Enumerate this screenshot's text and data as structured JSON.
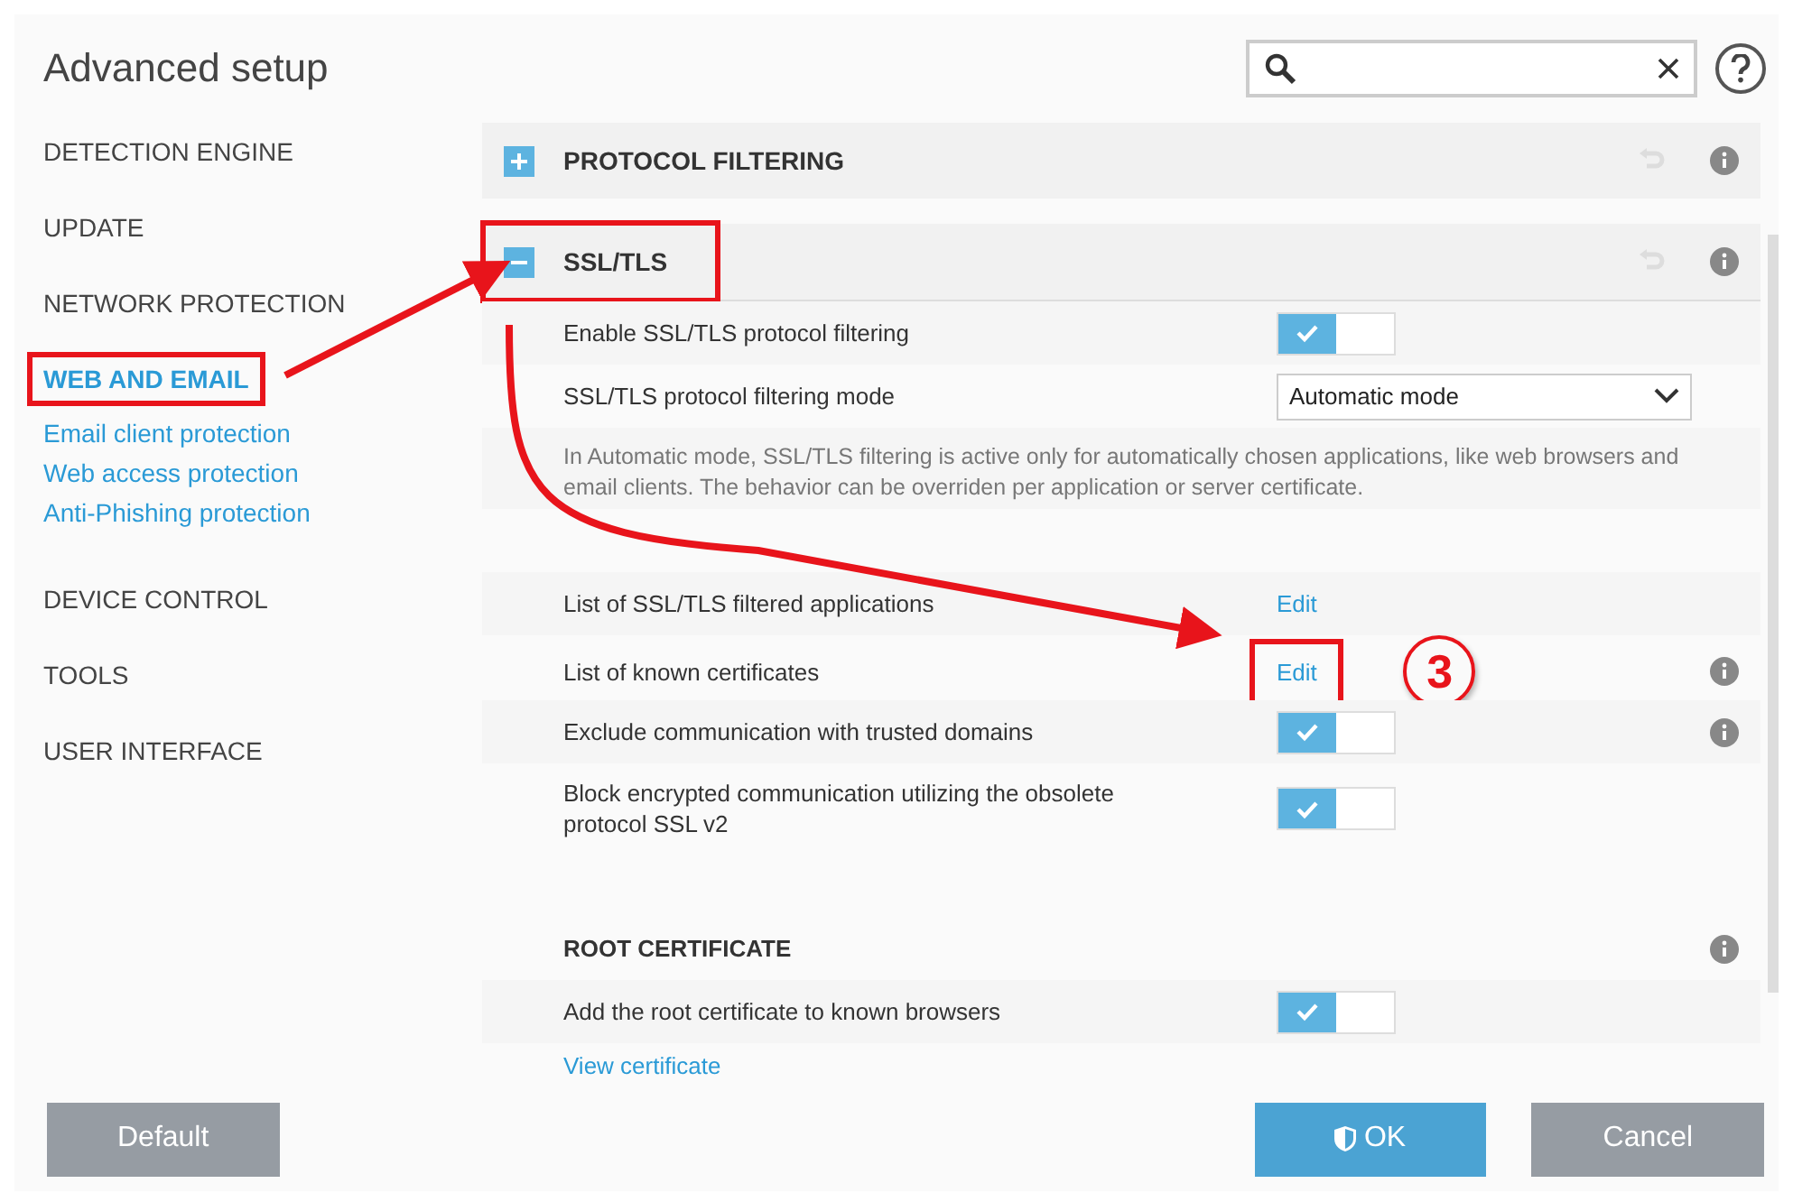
{
  "window": {
    "title": "Advanced setup"
  },
  "sidebar": {
    "items": [
      {
        "label": "DETECTION ENGINE",
        "selected": false,
        "highlighted": false
      },
      {
        "label": "UPDATE",
        "selected": false,
        "highlighted": false
      },
      {
        "label": "NETWORK PROTECTION",
        "selected": false,
        "highlighted": false
      },
      {
        "label": "WEB AND EMAIL",
        "selected": true,
        "highlighted": true,
        "children": [
          {
            "label": "Email client protection"
          },
          {
            "label": "Web access protection"
          },
          {
            "label": "Anti-Phishing protection"
          }
        ]
      },
      {
        "label": "DEVICE CONTROL",
        "selected": false,
        "highlighted": false
      },
      {
        "label": "TOOLS",
        "selected": false,
        "highlighted": false
      },
      {
        "label": "USER INTERFACE",
        "selected": false,
        "highlighted": false
      }
    ]
  },
  "sections": [
    {
      "title": "PROTOCOL FILTERING",
      "expanded": false,
      "highlighted": false
    },
    {
      "title": "SSL/TLS",
      "expanded": true,
      "highlighted": true,
      "rows": [
        {
          "kind": "toggle",
          "label": "Enable SSL/TLS protocol filtering",
          "on": true,
          "info": false
        },
        {
          "kind": "select",
          "label": "SSL/TLS protocol filtering mode",
          "value": "Automatic mode"
        },
        {
          "kind": "note",
          "text": "In Automatic mode, SSL/TLS filtering is active only for automatically chosen applications, like web browsers and email clients. The behavior can be overriden per application or server certificate."
        },
        {
          "kind": "spacer"
        },
        {
          "kind": "link",
          "label": "List of SSL/TLS filtered applications",
          "link": "Edit",
          "highlighted": false,
          "info": false
        },
        {
          "kind": "link",
          "label": "List of known certificates",
          "link": "Edit",
          "highlighted": true,
          "step": "3",
          "info": true
        },
        {
          "kind": "toggle",
          "label": "Exclude communication with trusted domains",
          "on": true,
          "info": true
        },
        {
          "kind": "toggle",
          "label": "Block encrypted communication utilizing the obsolete protocol SSL v2",
          "on": true,
          "info": false
        },
        {
          "kind": "spacer"
        },
        {
          "kind": "heading",
          "label": "ROOT CERTIFICATE",
          "info": true
        },
        {
          "kind": "toggle",
          "label": "Add the root certificate to known browsers",
          "on": true,
          "info": false
        },
        {
          "kind": "action",
          "label": "View certificate"
        }
      ]
    }
  ],
  "buttons": [
    {
      "label": "Default",
      "kind": "secondary"
    },
    {
      "label": "OK",
      "kind": "primary"
    },
    {
      "label": "Cancel",
      "kind": "secondary"
    }
  ]
}
